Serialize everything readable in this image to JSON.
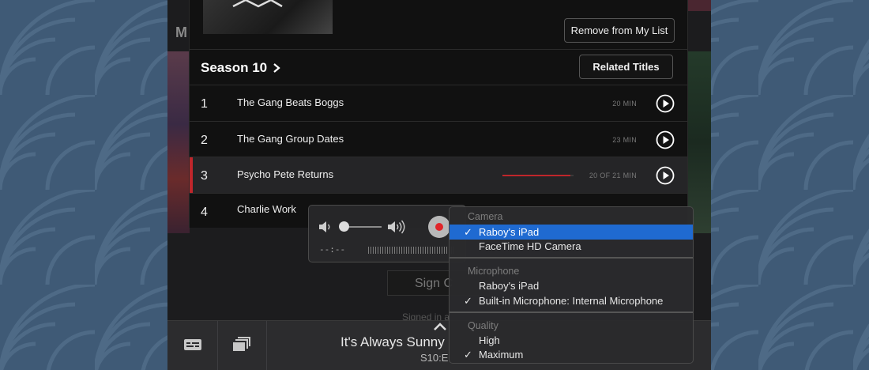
{
  "background": {
    "m_letter": "M"
  },
  "my_list": {
    "remove_label": "Remove from My List"
  },
  "season": {
    "title": "Season 10",
    "related_label": "Related Titles"
  },
  "episodes": [
    {
      "number": "1",
      "title": "The Gang Beats Boggs",
      "duration": "20 MIN",
      "progress": null
    },
    {
      "number": "2",
      "title": "The Gang Group Dates",
      "duration": "23 MIN",
      "progress": null
    },
    {
      "number": "3",
      "title": "Psycho Pete Returns",
      "duration": "20 OF 21 MIN",
      "progress": 0.95
    },
    {
      "number": "4",
      "title": "Charlie Work",
      "duration": "",
      "progress": null
    }
  ],
  "signin": {
    "button_label": "Sign C",
    "signed_in_text": "Signed in a"
  },
  "now_playing": {
    "title": "It's Always Sunny",
    "subtitle": "S10:E"
  },
  "recorder": {
    "timecode": "--:--",
    "volume": 0.0
  },
  "menu": {
    "camera_header": "Camera",
    "camera_items": [
      {
        "label": "Raboy's iPad",
        "checked": true,
        "selected": true
      },
      {
        "label": "FaceTime HD Camera",
        "checked": false,
        "selected": false
      }
    ],
    "microphone_header": "Microphone",
    "microphone_items": [
      {
        "label": "Raboy's iPad",
        "checked": false
      },
      {
        "label": "Built-in Microphone: Internal Microphone",
        "checked": true
      }
    ],
    "quality_header": "Quality",
    "quality_items": [
      {
        "label": "High",
        "checked": false
      },
      {
        "label": "Maximum",
        "checked": true
      }
    ],
    "check_glyph": "✓"
  },
  "colors": {
    "accent_red": "#c0262b",
    "menu_selected": "#1f6ad1",
    "desktop": "#3f5a76"
  }
}
